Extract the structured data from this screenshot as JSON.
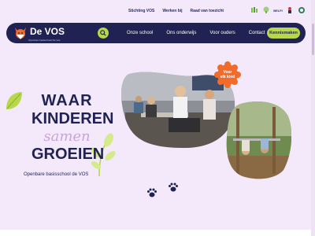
{
  "topbar": {
    "links": [
      "Stichting VOS",
      "Werken bij",
      "Raad van toezicht"
    ],
    "badges": [
      "leaf-badge",
      "tree-badge",
      "BELFI",
      "person-badge",
      "globe-badge"
    ]
  },
  "nav": {
    "brand": "De VOS",
    "tagline": "Openbare basisschool De Vos",
    "items": [
      "Onze school",
      "Ons onderwijs",
      "Voor ouders",
      "Contact"
    ],
    "cta": "Kennismaken"
  },
  "hero": {
    "line1": "WAAR",
    "line2": "KINDEREN",
    "line3": "samen",
    "line4": "GROEIEN",
    "subline": "Openbare basisschool de VOS",
    "sticker_line1": "Voor",
    "sticker_line2": "elk kind"
  },
  "colors": {
    "background": "#f4e8fb",
    "navy": "#1f2252",
    "accent_green": "#b7d84a",
    "accent_orange": "#f26b2a",
    "lilac": "#c9a6d8"
  }
}
